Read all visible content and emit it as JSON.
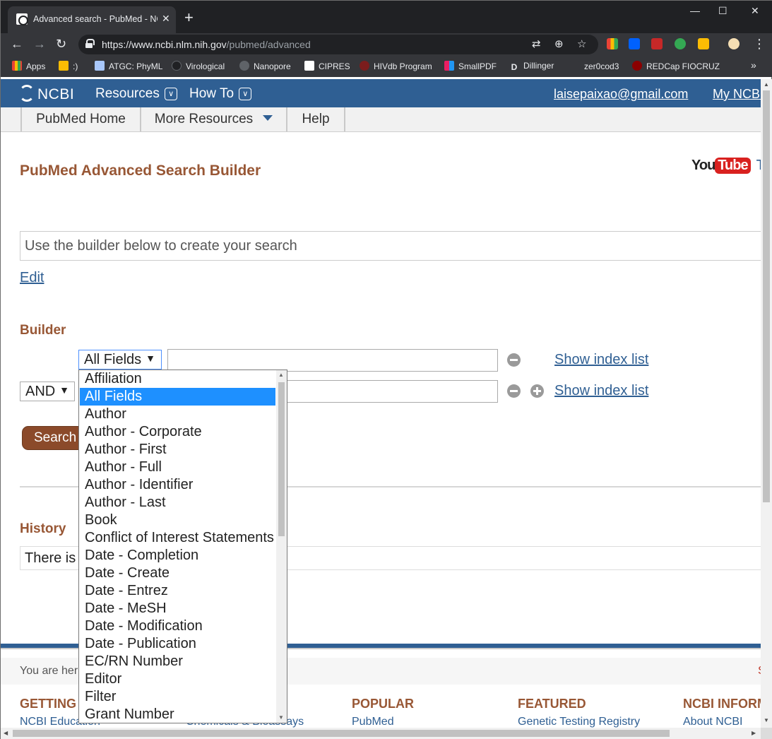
{
  "browser": {
    "tab_title": "Advanced search - PubMed - NC",
    "new_tab": "+",
    "close_tab": "✕",
    "url_host": "https://www.ncbi.nlm.nih.gov",
    "url_path": "/pubmed/advanced",
    "window_controls": {
      "minimize": "—",
      "maximize": "☐",
      "close": "✕"
    },
    "nav": {
      "back": "←",
      "forward": "→",
      "reload": "↻",
      "menu": "⋮"
    },
    "bookmarks": [
      {
        "label": "Apps",
        "color": "#ea4335"
      },
      {
        "label": ":)",
        "color": "#fbbc04"
      },
      {
        "label": "ATGC: PhyML",
        "color": "#a8c7fa"
      },
      {
        "label": "Virological",
        "color": "#202124"
      },
      {
        "label": "Nanopore",
        "color": "#5f6368"
      },
      {
        "label": "CIPRES",
        "color": "#ffffff"
      },
      {
        "label": "HIVdb Program",
        "color": "#7b1d1d"
      },
      {
        "label": "SmallPDF",
        "color": "#e91e63"
      },
      {
        "label": "Dillinger",
        "color": "#35363a"
      },
      {
        "label": "zer0cod3",
        "color": "#35363a"
      },
      {
        "label": "REDCap FIOCRUZ",
        "color": "#8b0000"
      }
    ],
    "bookmarks_overflow": "»"
  },
  "ncbi_header": {
    "logo": "NCBI",
    "resources": "Resources",
    "howto": "How To",
    "user_email": "laisepaixao@gmail.com",
    "my_ncbi": "My NCBI"
  },
  "subnav": {
    "items": [
      "PubMed Home",
      "More Resources",
      "Help"
    ]
  },
  "page": {
    "title": "PubMed Advanced Search Builder",
    "youtube_you": "You",
    "youtube_tube": "Tube",
    "youtube_tail": "Tu",
    "query_placeholder": "Use the builder below to create your search",
    "edit_link": "Edit",
    "builder_heading": "Builder",
    "field_selected": "All Fields",
    "operator_selected": "AND",
    "show_index_1": "Show index list",
    "show_index_2": "Show index list",
    "search_button": "Search",
    "history_heading": "History",
    "history_text": "There is n",
    "you_are_here": "You are her",
    "footer_red": "S"
  },
  "footer": {
    "getting_started": "GETTING",
    "ncbi_education": "NCBI Education",
    "chemicals": "Chemicals & Bioassays",
    "popular": "POPULAR",
    "pubmed": "PubMed",
    "featured": "FEATURED",
    "genetic_testing": "Genetic Testing Registry",
    "ncbi_info": "NCBI INFORM",
    "about_ncbi": "About NCBI"
  },
  "field_options": [
    "Affiliation",
    "All Fields",
    "Author",
    "Author - Corporate",
    "Author - First",
    "Author - Full",
    "Author - Identifier",
    "Author - Last",
    "Book",
    "Conflict of Interest Statements",
    "Date - Completion",
    "Date - Create",
    "Date - Entrez",
    "Date - MeSH",
    "Date - Modification",
    "Date - Publication",
    "EC/RN Number",
    "Editor",
    "Filter",
    "Grant Number"
  ],
  "field_options_selected_index": 1,
  "colors": {
    "ncbi_blue": "#2f5f93",
    "heading_brown": "#985735",
    "search_button": "#8b4a2a",
    "selection_blue": "#1e90ff"
  }
}
